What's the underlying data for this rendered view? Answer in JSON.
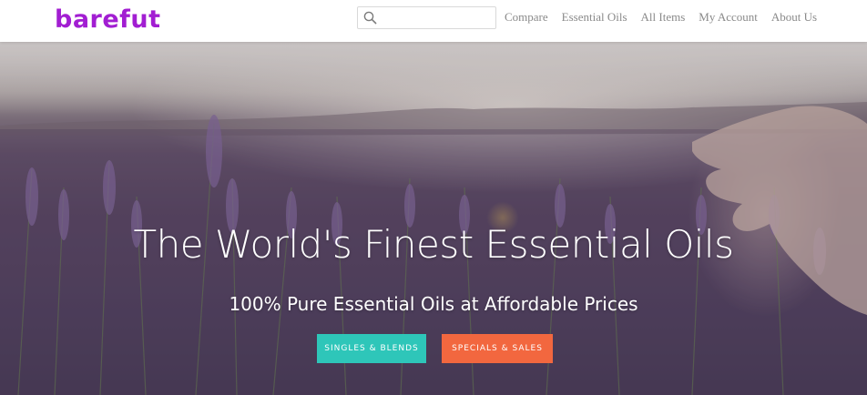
{
  "brand": {
    "logo_text": "barefut",
    "logo_color": "#a21ed2"
  },
  "search": {
    "placeholder": "",
    "value": "",
    "icon": "search-icon"
  },
  "nav": {
    "items": [
      {
        "label": "Compare"
      },
      {
        "label": "Essential Oils"
      },
      {
        "label": "All Items"
      },
      {
        "label": "My Account"
      },
      {
        "label": "About Us"
      }
    ]
  },
  "hero": {
    "title": "The World's Finest Essential Oils",
    "subtitle": "100% Pure Essential Oils at Affordable Prices",
    "buttons": {
      "primary_label": "SINGLES & BLENDS",
      "primary_color": "#2ec6b9",
      "secondary_label": "SPECIALS & SALES",
      "secondary_color": "#f2673f"
    }
  }
}
